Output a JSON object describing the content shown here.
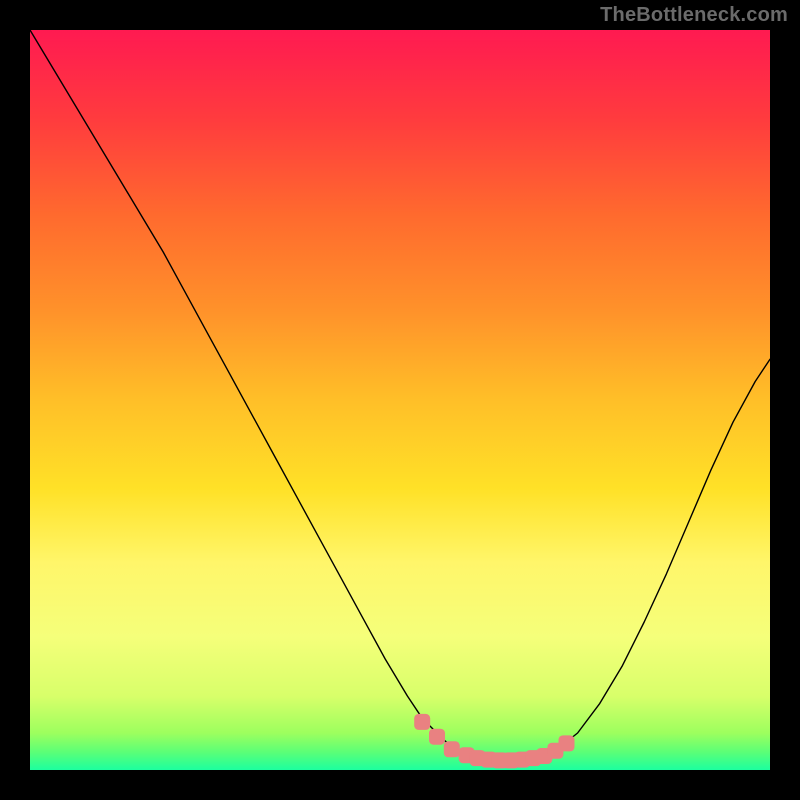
{
  "watermark": "TheBottleneck.com",
  "chart_data": {
    "type": "line",
    "title": "",
    "xlabel": "",
    "ylabel": "",
    "xlim": [
      0,
      100
    ],
    "ylim": [
      0,
      100
    ],
    "grid": false,
    "legend": false,
    "background_gradient": {
      "stops": [
        {
          "offset": 0.0,
          "color": "#ff1a51"
        },
        {
          "offset": 0.12,
          "color": "#ff3b3e"
        },
        {
          "offset": 0.25,
          "color": "#ff6a2e"
        },
        {
          "offset": 0.38,
          "color": "#ff922a"
        },
        {
          "offset": 0.5,
          "color": "#ffbf28"
        },
        {
          "offset": 0.62,
          "color": "#ffe127"
        },
        {
          "offset": 0.72,
          "color": "#fff66a"
        },
        {
          "offset": 0.82,
          "color": "#f5ff7a"
        },
        {
          "offset": 0.9,
          "color": "#d8ff6a"
        },
        {
          "offset": 0.95,
          "color": "#9dff5e"
        },
        {
          "offset": 0.975,
          "color": "#5dff76"
        },
        {
          "offset": 1.0,
          "color": "#1cff9f"
        }
      ]
    },
    "series": [
      {
        "name": "bottleneck-curve",
        "color": "#000000",
        "width": 1.4,
        "x": [
          0.0,
          3.0,
          6.0,
          9.0,
          12.0,
          15.0,
          18.0,
          21.0,
          24.0,
          27.0,
          30.0,
          33.0,
          36.0,
          39.0,
          42.0,
          45.0,
          48.0,
          51.0,
          53.0,
          56.0,
          58.0,
          60.0,
          62.0,
          64.0,
          66.0,
          68.0,
          69.0,
          71.0,
          74.0,
          77.0,
          80.0,
          83.0,
          86.0,
          89.0,
          92.0,
          95.0,
          98.0,
          100.0
        ],
        "y": [
          100.0,
          95.0,
          90.0,
          85.0,
          80.0,
          75.0,
          70.0,
          64.5,
          59.0,
          53.5,
          48.0,
          42.5,
          37.0,
          31.5,
          26.0,
          20.5,
          15.0,
          10.0,
          7.0,
          4.0,
          2.5,
          1.8,
          1.5,
          1.3,
          1.3,
          1.5,
          1.8,
          2.6,
          5.0,
          9.0,
          14.0,
          20.0,
          26.5,
          33.5,
          40.5,
          47.0,
          52.5,
          55.5
        ]
      },
      {
        "name": "marker-band",
        "type": "marker-strip",
        "color": "#e98181",
        "marker_size": 16,
        "x": [
          53.0,
          55.0,
          57.0,
          59.0,
          60.5,
          62.0,
          63.5,
          65.0,
          66.5,
          68.0,
          69.5,
          71.0,
          72.5
        ],
        "y": [
          6.5,
          4.5,
          2.8,
          2.0,
          1.6,
          1.4,
          1.3,
          1.3,
          1.4,
          1.6,
          1.9,
          2.6,
          3.6
        ]
      }
    ]
  }
}
